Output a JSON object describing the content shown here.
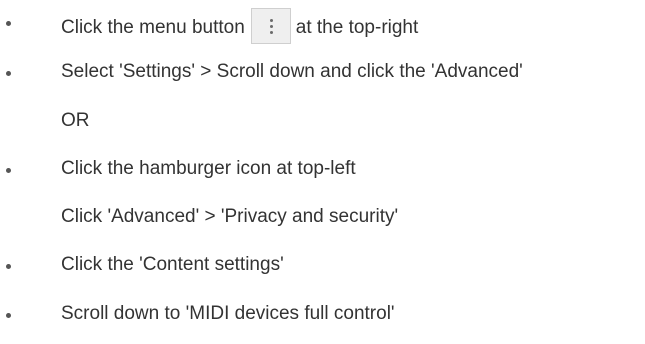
{
  "instructions": [
    {
      "text_before": "Click the menu button",
      "icon": "kebab-menu-icon",
      "text_after": "at the top-right"
    },
    {
      "text": "Select 'Settings' > Scroll down and click the 'Advanced'"
    },
    {
      "text": "OR"
    },
    {
      "text": "Click the hamburger icon at top-left"
    },
    {
      "text": "Click 'Advanced' > 'Privacy and security'"
    },
    {
      "text": "Click the 'Content settings'"
    },
    {
      "text": "Scroll down to 'MIDI devices full control'"
    }
  ]
}
